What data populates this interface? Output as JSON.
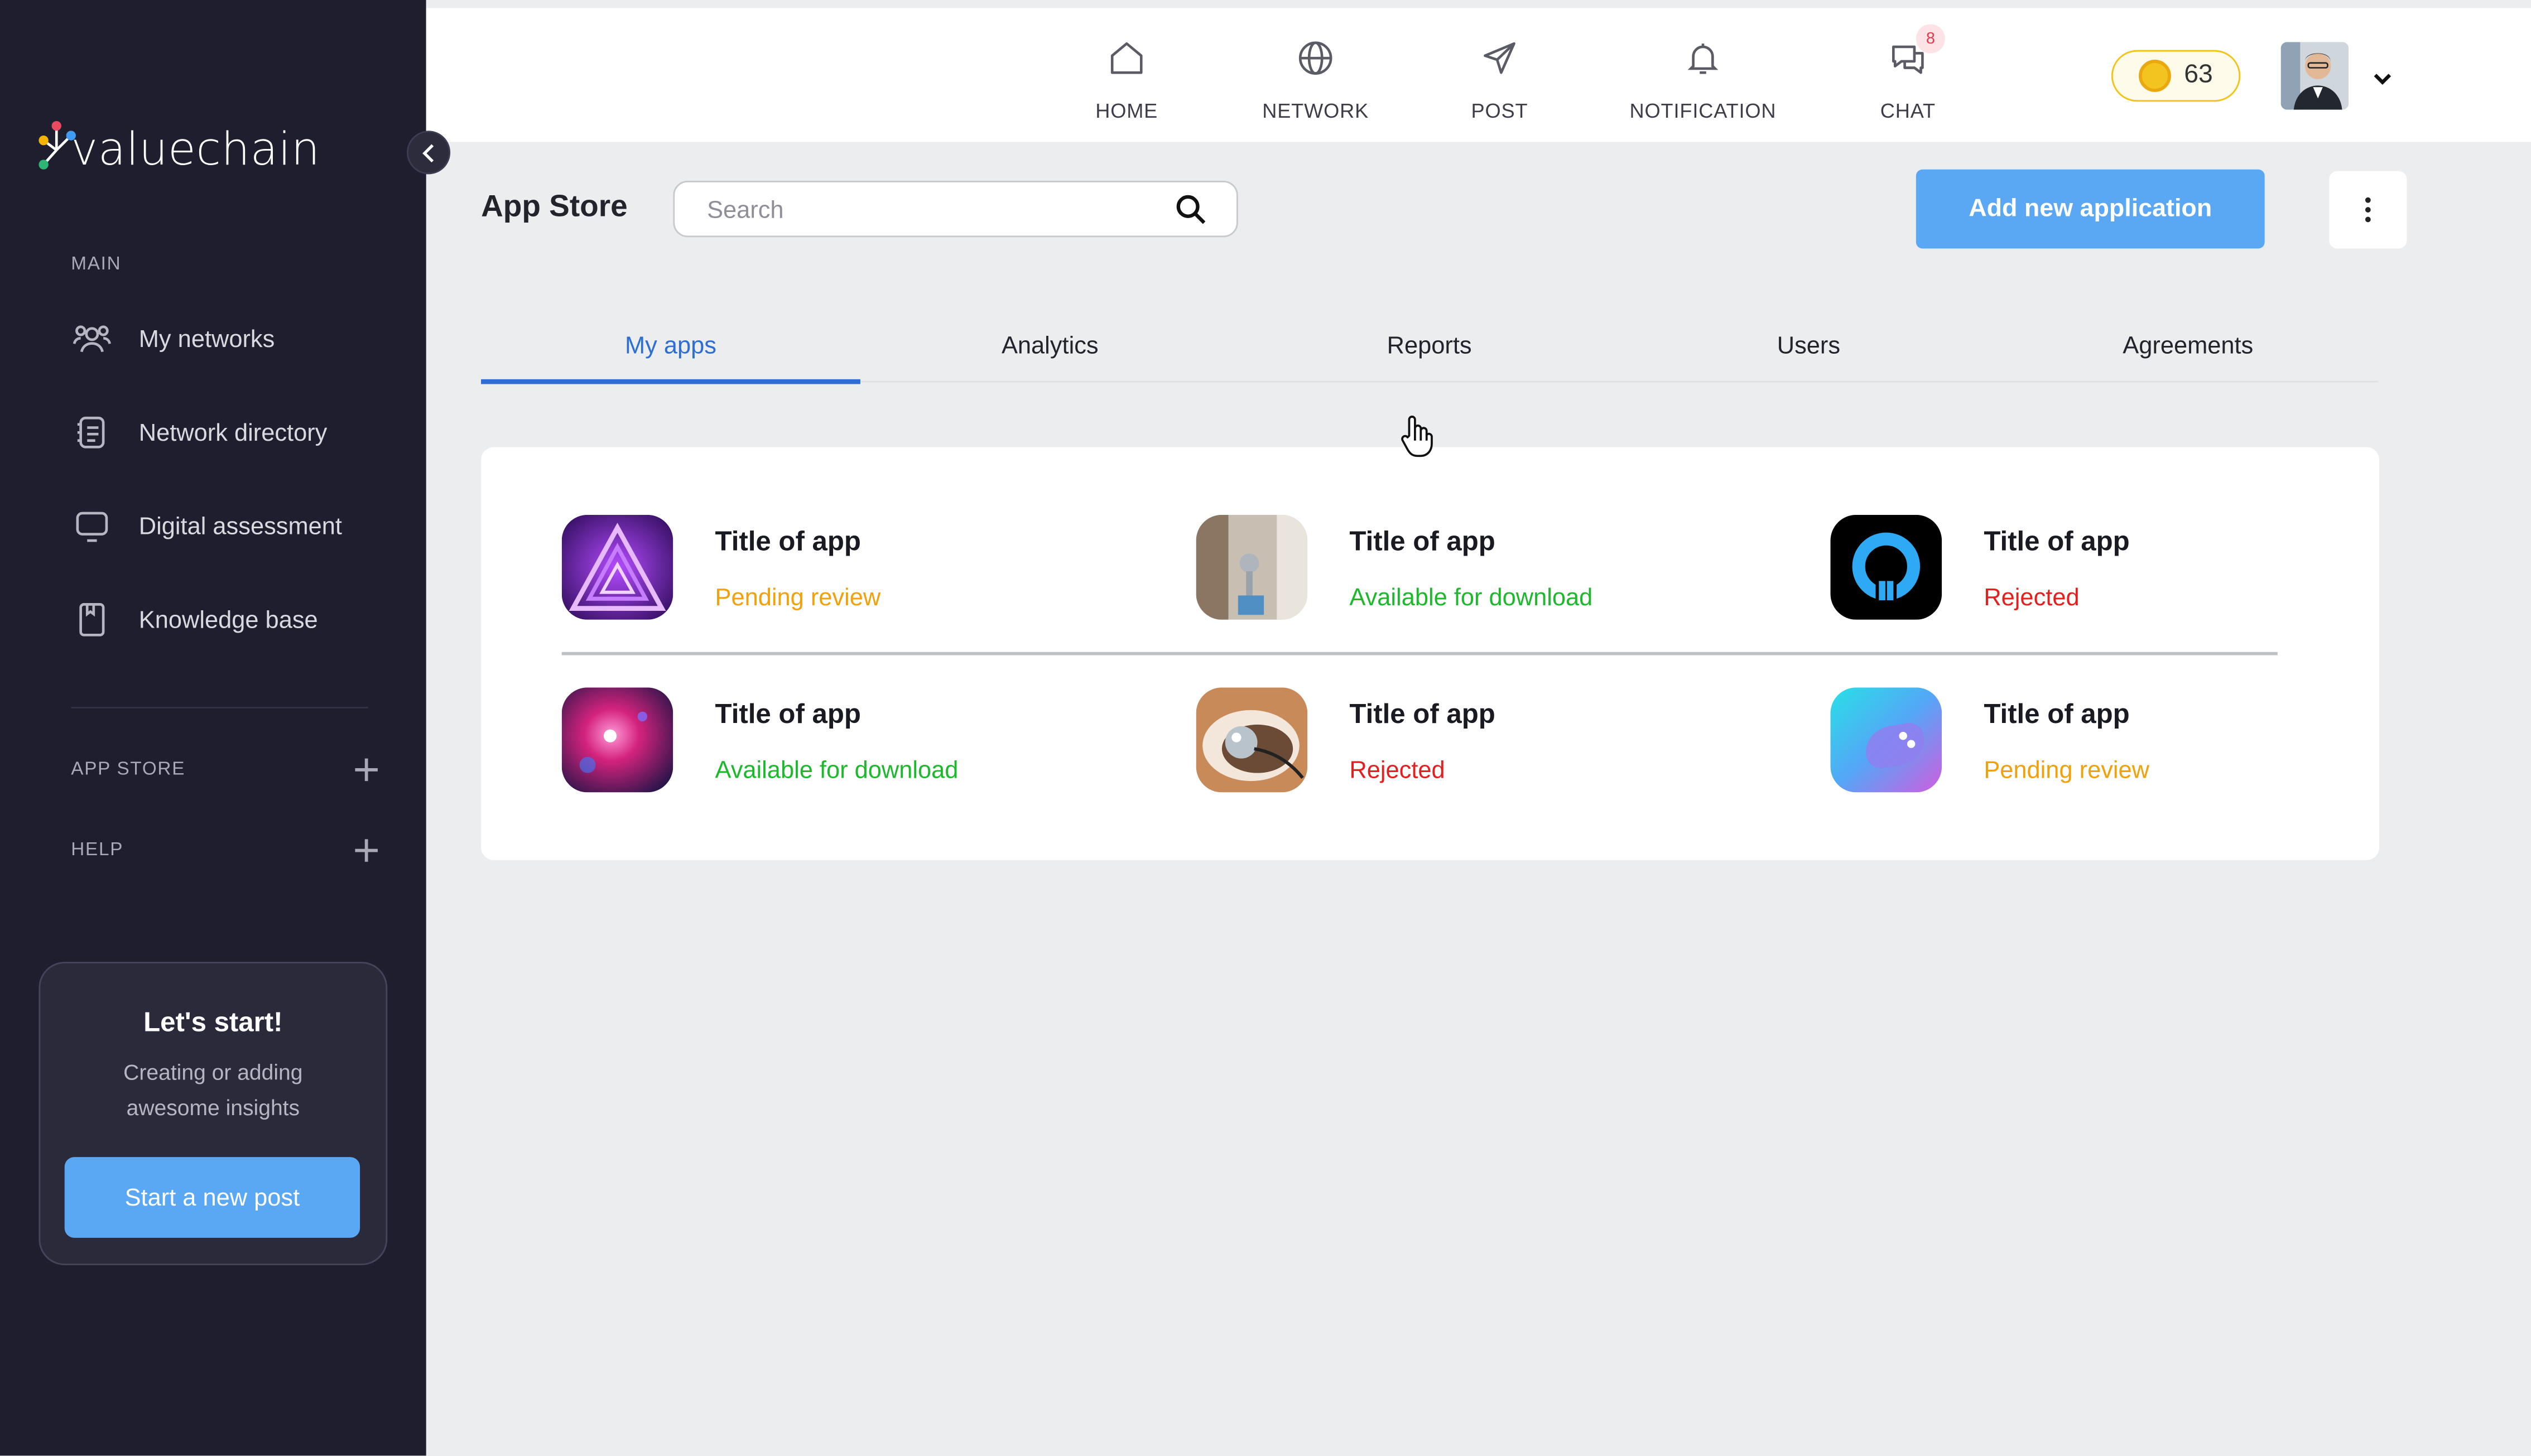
{
  "brand": {
    "name": "valuechain"
  },
  "sidebar": {
    "main_label": "MAIN",
    "items": [
      {
        "label": "My networks",
        "icon": "users-icon"
      },
      {
        "label": "Network directory",
        "icon": "directory-icon"
      },
      {
        "label": "Digital assessment",
        "icon": "monitor-icon"
      },
      {
        "label": "Knowledge base",
        "icon": "book-icon"
      }
    ],
    "app_store_label": "APP STORE",
    "help_label": "HELP",
    "start_card": {
      "title": "Let's start!",
      "description": "Creating or adding awesome insights",
      "button_label": "Start a new post"
    }
  },
  "topnav": {
    "items": [
      {
        "label": "HOME",
        "icon": "home-icon"
      },
      {
        "label": "NETWORK",
        "icon": "globe-icon"
      },
      {
        "label": "POST",
        "icon": "send-icon"
      },
      {
        "label": "NOTIFICATION",
        "icon": "bell-icon"
      },
      {
        "label": "CHAT",
        "icon": "chat-icon",
        "badge": "8"
      }
    ],
    "coins": "63"
  },
  "header": {
    "title": "App Store",
    "search_placeholder": "Search",
    "add_button_label": "Add new application"
  },
  "tabs": [
    {
      "label": "My apps",
      "active": true
    },
    {
      "label": "Analytics",
      "active": false
    },
    {
      "label": "Reports",
      "active": false
    },
    {
      "label": "Users",
      "active": false
    },
    {
      "label": "Agreements",
      "active": false
    }
  ],
  "apps": [
    {
      "title": "Title of app",
      "status": "Pending review",
      "status_color": "#f0a10c"
    },
    {
      "title": "Title of app",
      "status": "Available for download",
      "status_color": "#1db92d"
    },
    {
      "title": "Title of app",
      "status": "Rejected",
      "status_color": "#e41f1f"
    },
    {
      "title": "Title of app",
      "status": "Available for download",
      "status_color": "#1db92d"
    },
    {
      "title": "Title of app",
      "status": "Rejected",
      "status_color": "#e41f1f"
    },
    {
      "title": "Title of app",
      "status": "Pending review",
      "status_color": "#f0a10c"
    }
  ],
  "colors": {
    "sidebar_bg": "#1f1e2f",
    "accent": "#5aa7f3",
    "tab_active": "#2c6ed5",
    "page_bg": "#ecedef"
  }
}
